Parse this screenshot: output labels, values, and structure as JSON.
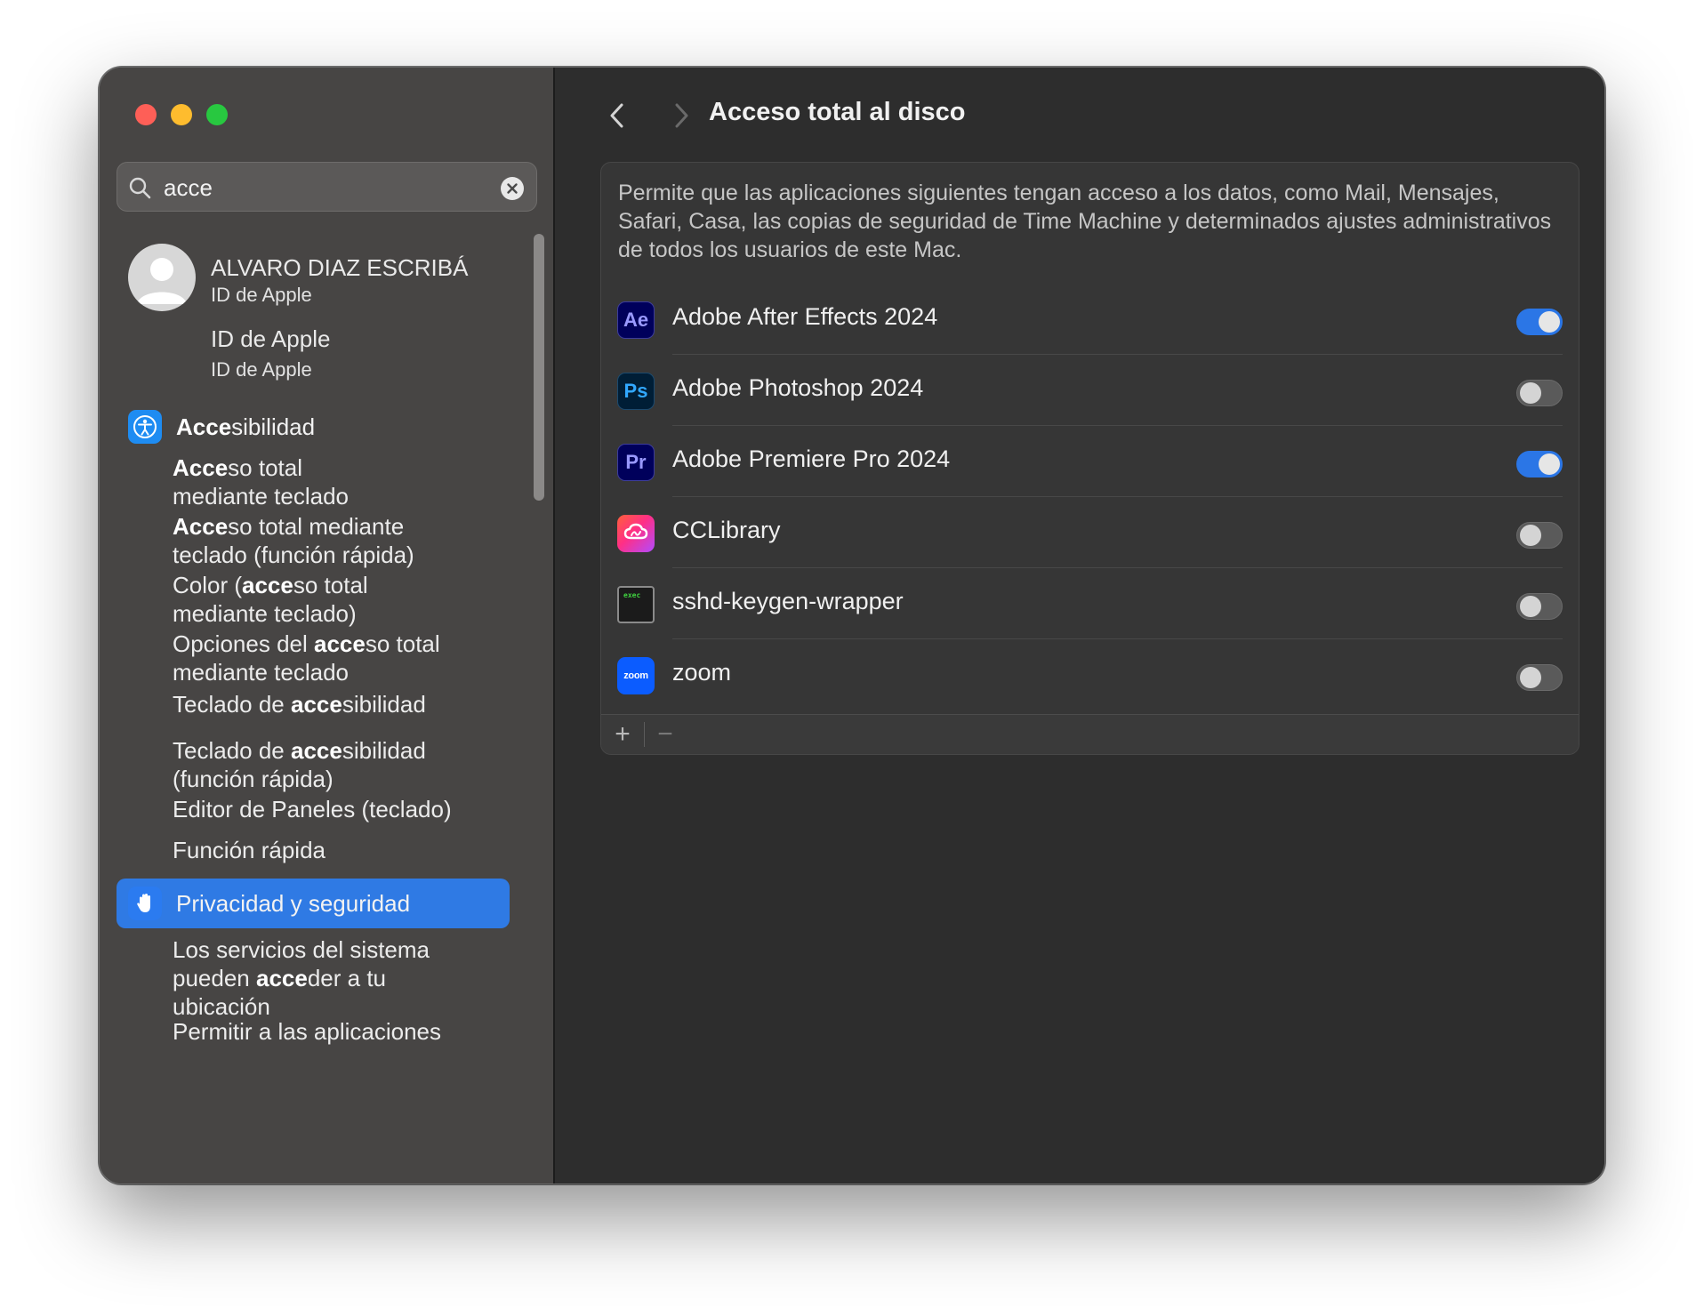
{
  "window": {
    "controls": [
      "close",
      "minimize",
      "zoom"
    ]
  },
  "search": {
    "value": "acce",
    "icon": "search-icon",
    "clear_icon": "clear-icon"
  },
  "sidebar": {
    "profile": {
      "name": "ALVARO DIAZ ESCRIBÁ",
      "subtitle": "ID de Apple"
    },
    "apple_id": {
      "title": "ID de Apple",
      "subtitle": "ID de Apple"
    },
    "sections": [
      {
        "label": "Accesibilidad",
        "icon": "accessibility-icon",
        "items": [
          "Acceso total\nmediante teclado",
          "Acceso total mediante\nteclado (función rápida)",
          "Color (acceso total\nmediante teclado)",
          "Opciones del acceso total\nmediante teclado",
          "Teclado de accesibilidad",
          "Teclado de accesibilidad\n(función rápida)",
          "Editor de Paneles (teclado)",
          "Función rápida"
        ]
      },
      {
        "label": "Privacidad y seguridad",
        "icon": "hand-icon",
        "selected": true,
        "items": [
          "Los servicios del sistema\npueden acceder a tu\nubicación",
          "Permitir a las aplicaciones"
        ]
      }
    ]
  },
  "main": {
    "title": "Acceso total al disco",
    "description": "Permite que las aplicaciones siguientes tengan acceso a los datos, como Mail, Mensajes, Safari, Casa, las copias de seguridad de Time Machine y determinados ajustes administrativos de todos los usuarios de este Mac.",
    "apps": [
      {
        "name": "Adobe After Effects 2024",
        "icon": "after-effects-icon",
        "badge": "Ae",
        "enabled": true
      },
      {
        "name": "Adobe Photoshop 2024",
        "icon": "photoshop-icon",
        "badge": "Ps",
        "enabled": false
      },
      {
        "name": "Adobe Premiere Pro 2024",
        "icon": "premiere-pro-icon",
        "badge": "Pr",
        "enabled": true
      },
      {
        "name": "CCLibrary",
        "icon": "creative-cloud-icon",
        "badge": "",
        "enabled": false
      },
      {
        "name": "sshd-keygen-wrapper",
        "icon": "terminal-exec-icon",
        "badge": "exec",
        "enabled": false
      },
      {
        "name": "zoom",
        "icon": "zoom-icon",
        "badge": "zoom",
        "enabled": false
      }
    ],
    "footer": {
      "add": "+",
      "remove": "−"
    }
  },
  "colors": {
    "accent": "#2f7ae4",
    "toggle_on": "#2b76e6",
    "sidebar_bg": "#474544",
    "main_bg": "#2d2d2d"
  }
}
